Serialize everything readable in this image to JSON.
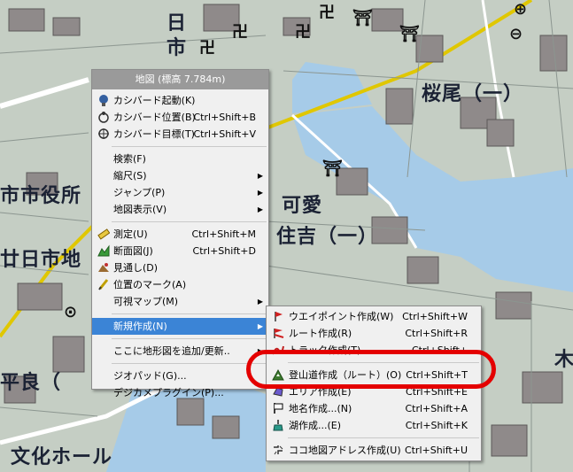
{
  "map": {
    "labels": {
      "sakurao": "桜尾（一）",
      "city_hall": "市市役所",
      "kawai": "可愛",
      "sumiyoshi": "住吉（一）",
      "hatsukaichi": "廿日市地",
      "taira": "平良（",
      "bunka_hall": "文化ホール",
      "hi": "日",
      "ichi": "市",
      "ki": "木"
    }
  },
  "context_menu": {
    "title": "地図 (標高  7.784m)",
    "items": [
      {
        "icon": "kashmir-launch-icon",
        "label": "カシバード起動(K)",
        "shortcut": ""
      },
      {
        "icon": "kashmir-position-icon",
        "label": "カシバード位置(B)",
        "shortcut": "Ctrl+Shift+B"
      },
      {
        "icon": "kashmir-target-icon",
        "label": "カシバード目標(T)",
        "shortcut": "Ctrl+Shift+V"
      },
      {
        "icon": "",
        "label": "検索(F)",
        "shortcut": ""
      },
      {
        "icon": "",
        "label": "縮尺(S)",
        "shortcut": ""
      },
      {
        "icon": "",
        "label": "ジャンプ(P)",
        "shortcut": ""
      },
      {
        "icon": "",
        "label": "地図表示(V)",
        "shortcut": ""
      },
      {
        "icon": "ruler-icon",
        "label": "測定(U)",
        "shortcut": "Ctrl+Shift+M"
      },
      {
        "icon": "cross-section-icon",
        "label": "断面図(J)",
        "shortcut": "Ctrl+Shift+D"
      },
      {
        "icon": "line-of-sight-icon",
        "label": "見通し(D)",
        "shortcut": ""
      },
      {
        "icon": "position-mark-icon",
        "label": "位置のマーク(A)",
        "shortcut": ""
      },
      {
        "icon": "",
        "label": "可視マップ(M)",
        "shortcut": ""
      },
      {
        "icon": "",
        "label": "新規作成(N)",
        "shortcut": ""
      },
      {
        "icon": "",
        "label": "ここに地形図を追加/更新..",
        "shortcut": ""
      },
      {
        "icon": "",
        "label": "ジオパッド(G)...",
        "shortcut": ""
      },
      {
        "icon": "",
        "label": "デジカメプラグイン(P)...",
        "shortcut": ""
      }
    ]
  },
  "submenu": {
    "items": [
      {
        "icon": "waypoint-icon",
        "label": "ウエイポイント作成(W)",
        "shortcut": "Ctrl+Shift+W"
      },
      {
        "icon": "route-icon",
        "label": "ルート作成(R)",
        "shortcut": "Ctrl+Shift+R"
      },
      {
        "icon": "track-icon",
        "label": "トラック作成(T)",
        "shortcut": "Ctrl+Shift+"
      },
      {
        "icon": "mountain-trail-icon",
        "label": "登山道作成（ルート）(O)",
        "shortcut": "Ctrl+Shift+T"
      },
      {
        "icon": "area-icon",
        "label": "エリア作成(E)",
        "shortcut": "Ctrl+Shift+E"
      },
      {
        "icon": "place-name-flag-icon",
        "label": "地名作成...(N)",
        "shortcut": "Ctrl+Shift+A"
      },
      {
        "icon": "lake-icon",
        "label": "湖作成...(E)",
        "shortcut": "Ctrl+Shift+K"
      },
      {
        "icon": "map-address-icon",
        "label": "ココ地図アドレス作成(U)",
        "shortcut": "Ctrl+Shift+U"
      }
    ]
  },
  "colors": {
    "menu_bg": "#f0f0f0",
    "highlight": "#3b84d6",
    "annotation": "#e40000",
    "water": "#a6cbe8"
  }
}
